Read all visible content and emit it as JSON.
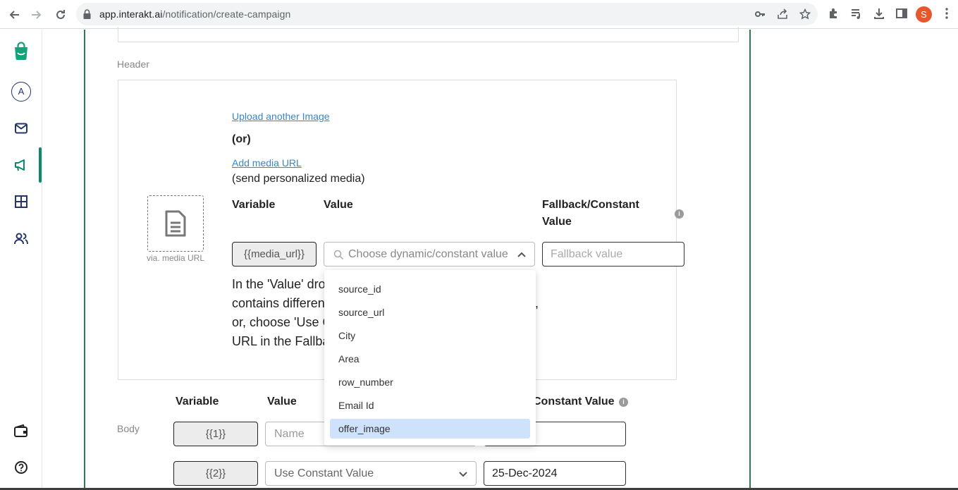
{
  "browser": {
    "url_host": "app.interakt.ai",
    "url_path": "/notification/create-campaign",
    "profile_initial": "S"
  },
  "sidebar": {
    "avatar_letter": "A",
    "items": [
      "logo-icon",
      "avatar",
      "mail-icon",
      "megaphone-icon",
      "grid-icon",
      "users-icon",
      "wallet-icon",
      "help-icon"
    ]
  },
  "header_section": {
    "label": "Header",
    "media_caption": "via. media URL",
    "upload_link": "Upload another Image",
    "or_text": "(or)",
    "add_media_link": "Add media URL",
    "personalized_text": "(send personalized media)",
    "col_variable": "Variable",
    "col_value": "Value",
    "col_fallback_1": "Fallback/Constant",
    "col_fallback_2": "Value",
    "variable_chip": "{{media_url}}",
    "value_placeholder": "Choose dynamic/constant value",
    "fallback_placeholder": "Fallback value",
    "help_lines": [
      "In the 'Value' dro",
      "contains differen",
      "or, choose 'Use C",
      "URL in the Fallba"
    ],
    "help_tail": ","
  },
  "dropdown": {
    "options": [
      "source_id",
      "source_url",
      "City",
      "Area",
      "row_number",
      "Email Id",
      "offer_image"
    ],
    "selected": "offer_image"
  },
  "body_section": {
    "label": "Body",
    "col_variable": "Variable",
    "col_value": "Value",
    "col_fallback": "Constant Value",
    "rows": [
      {
        "variable": "{{1}}",
        "value_placeholder": "Name",
        "fallback": ""
      },
      {
        "variable": "{{2}}",
        "value": "Use Constant Value",
        "fallback": "25-Dec-2024"
      }
    ]
  }
}
